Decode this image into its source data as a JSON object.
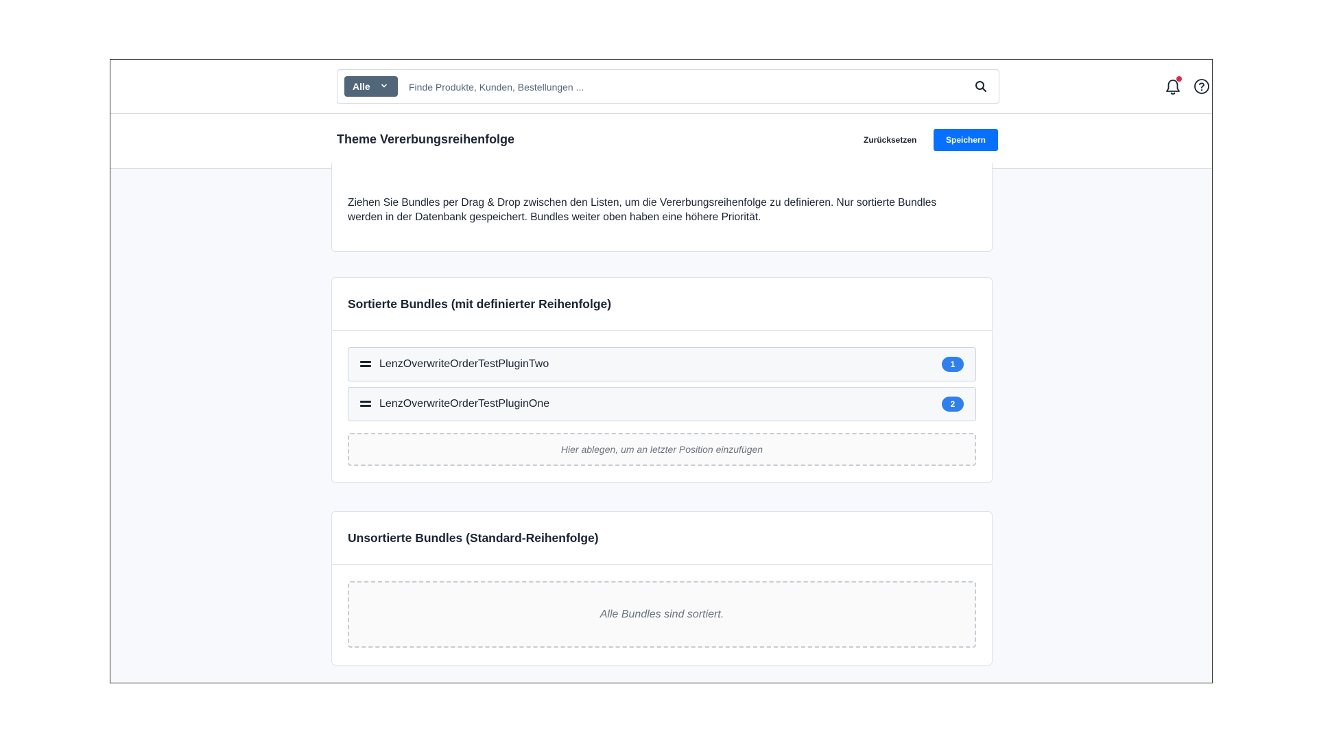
{
  "topbar": {
    "search_type": "Alle",
    "search_placeholder": "Finde Produkte, Kunden, Bestellungen ...",
    "icons": [
      "chevron-down-icon",
      "search-icon",
      "bell-icon",
      "help-icon"
    ],
    "notification_dot_color": "#de294c"
  },
  "header": {
    "title": "Theme Vererbungsreihenfolge",
    "reset_label": "Zurücksetzen",
    "save_label": "Speichern"
  },
  "intro": {
    "text": "Ziehen Sie Bundles per Drag & Drop zwischen den Listen, um die Vererbungsreihenfolge zu definieren. Nur sortierte Bundles werden in der Datenbank gespeichert. Bundles weiter oben haben eine höhere Priorität."
  },
  "sorted": {
    "title": "Sortierte Bundles (mit definierter Reihenfolge)",
    "items": [
      {
        "name": "LenzOverwriteOrderTestPluginTwo",
        "position": "1"
      },
      {
        "name": "LenzOverwriteOrderTestPluginOne",
        "position": "2"
      }
    ],
    "drop_hint": "Hier ablegen, um an letzter Position einzufügen"
  },
  "unsorted": {
    "title": "Unsortierte Bundles (Standard-Reihenfolge)",
    "empty_text": "Alle Bundles sind sortiert."
  },
  "colors": {
    "primary": "#0870ff",
    "badge": "#2f7fec",
    "search_type_bg": "#52667a"
  }
}
